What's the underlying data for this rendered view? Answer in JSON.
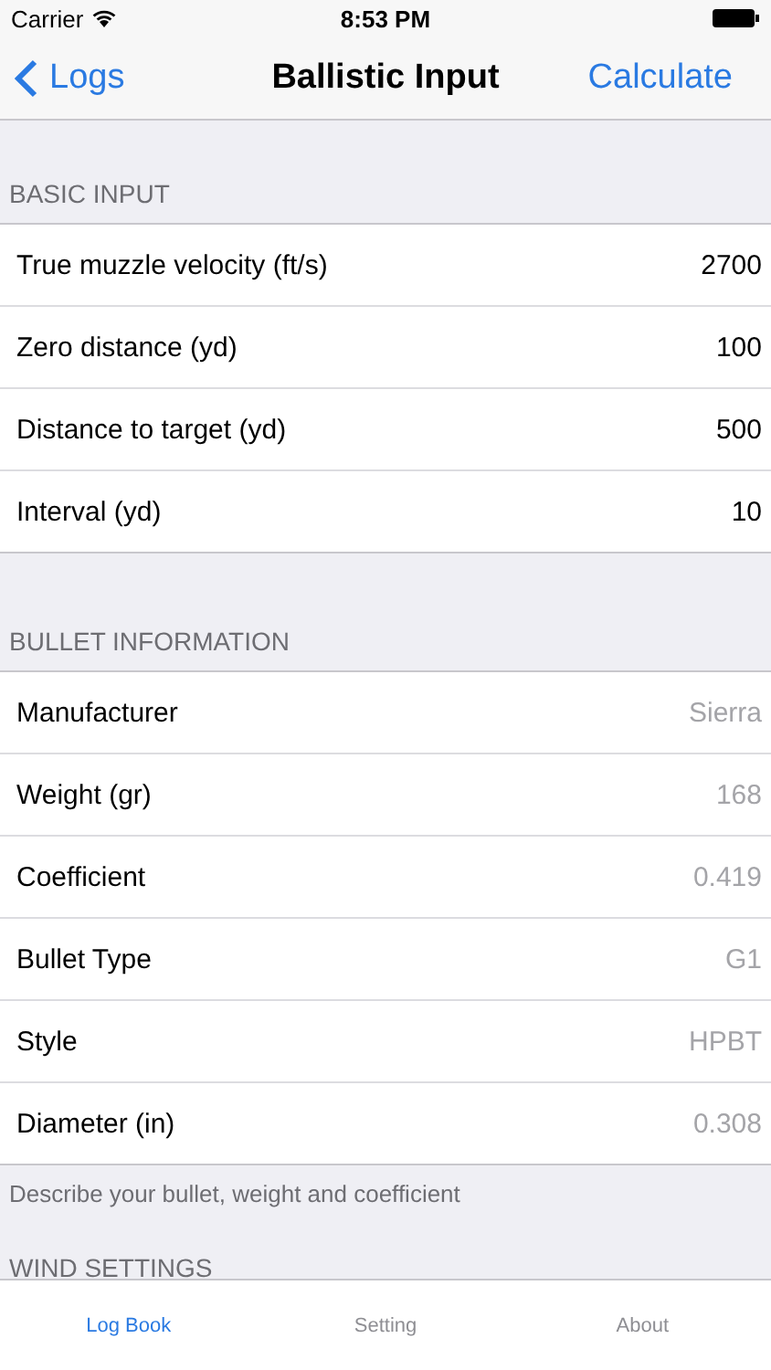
{
  "status_bar": {
    "carrier": "Carrier",
    "time": "8:53 PM"
  },
  "nav": {
    "back": "Logs",
    "title": "Ballistic Input",
    "action": "Calculate"
  },
  "sections": [
    {
      "header": "BASIC INPUT",
      "rows": [
        {
          "label": "True muzzle velocity (ft/s)",
          "value": "2700"
        },
        {
          "label": "Zero distance (yd)",
          "value": "100"
        },
        {
          "label": "Distance to target (yd)",
          "value": "500"
        },
        {
          "label": "Interval (yd)",
          "value": "10"
        }
      ]
    },
    {
      "header": "BULLET INFORMATION",
      "footer": "Describe your bullet, weight and coefficient",
      "rows": [
        {
          "label": "Manufacturer",
          "placeholder": "Sierra"
        },
        {
          "label": "Weight (gr)",
          "placeholder": "168"
        },
        {
          "label": "Coefficient",
          "placeholder": "0.419"
        },
        {
          "label": "Bullet Type",
          "placeholder": "G1"
        },
        {
          "label": "Style",
          "placeholder": "HPBT"
        },
        {
          "label": "Diameter (in)",
          "placeholder": "0.308"
        }
      ]
    },
    {
      "header": "WIND SETTINGS"
    }
  ],
  "tabs": [
    {
      "label": "Log Book",
      "selected": true
    },
    {
      "label": "Setting",
      "selected": false
    },
    {
      "label": "About",
      "selected": false
    }
  ]
}
